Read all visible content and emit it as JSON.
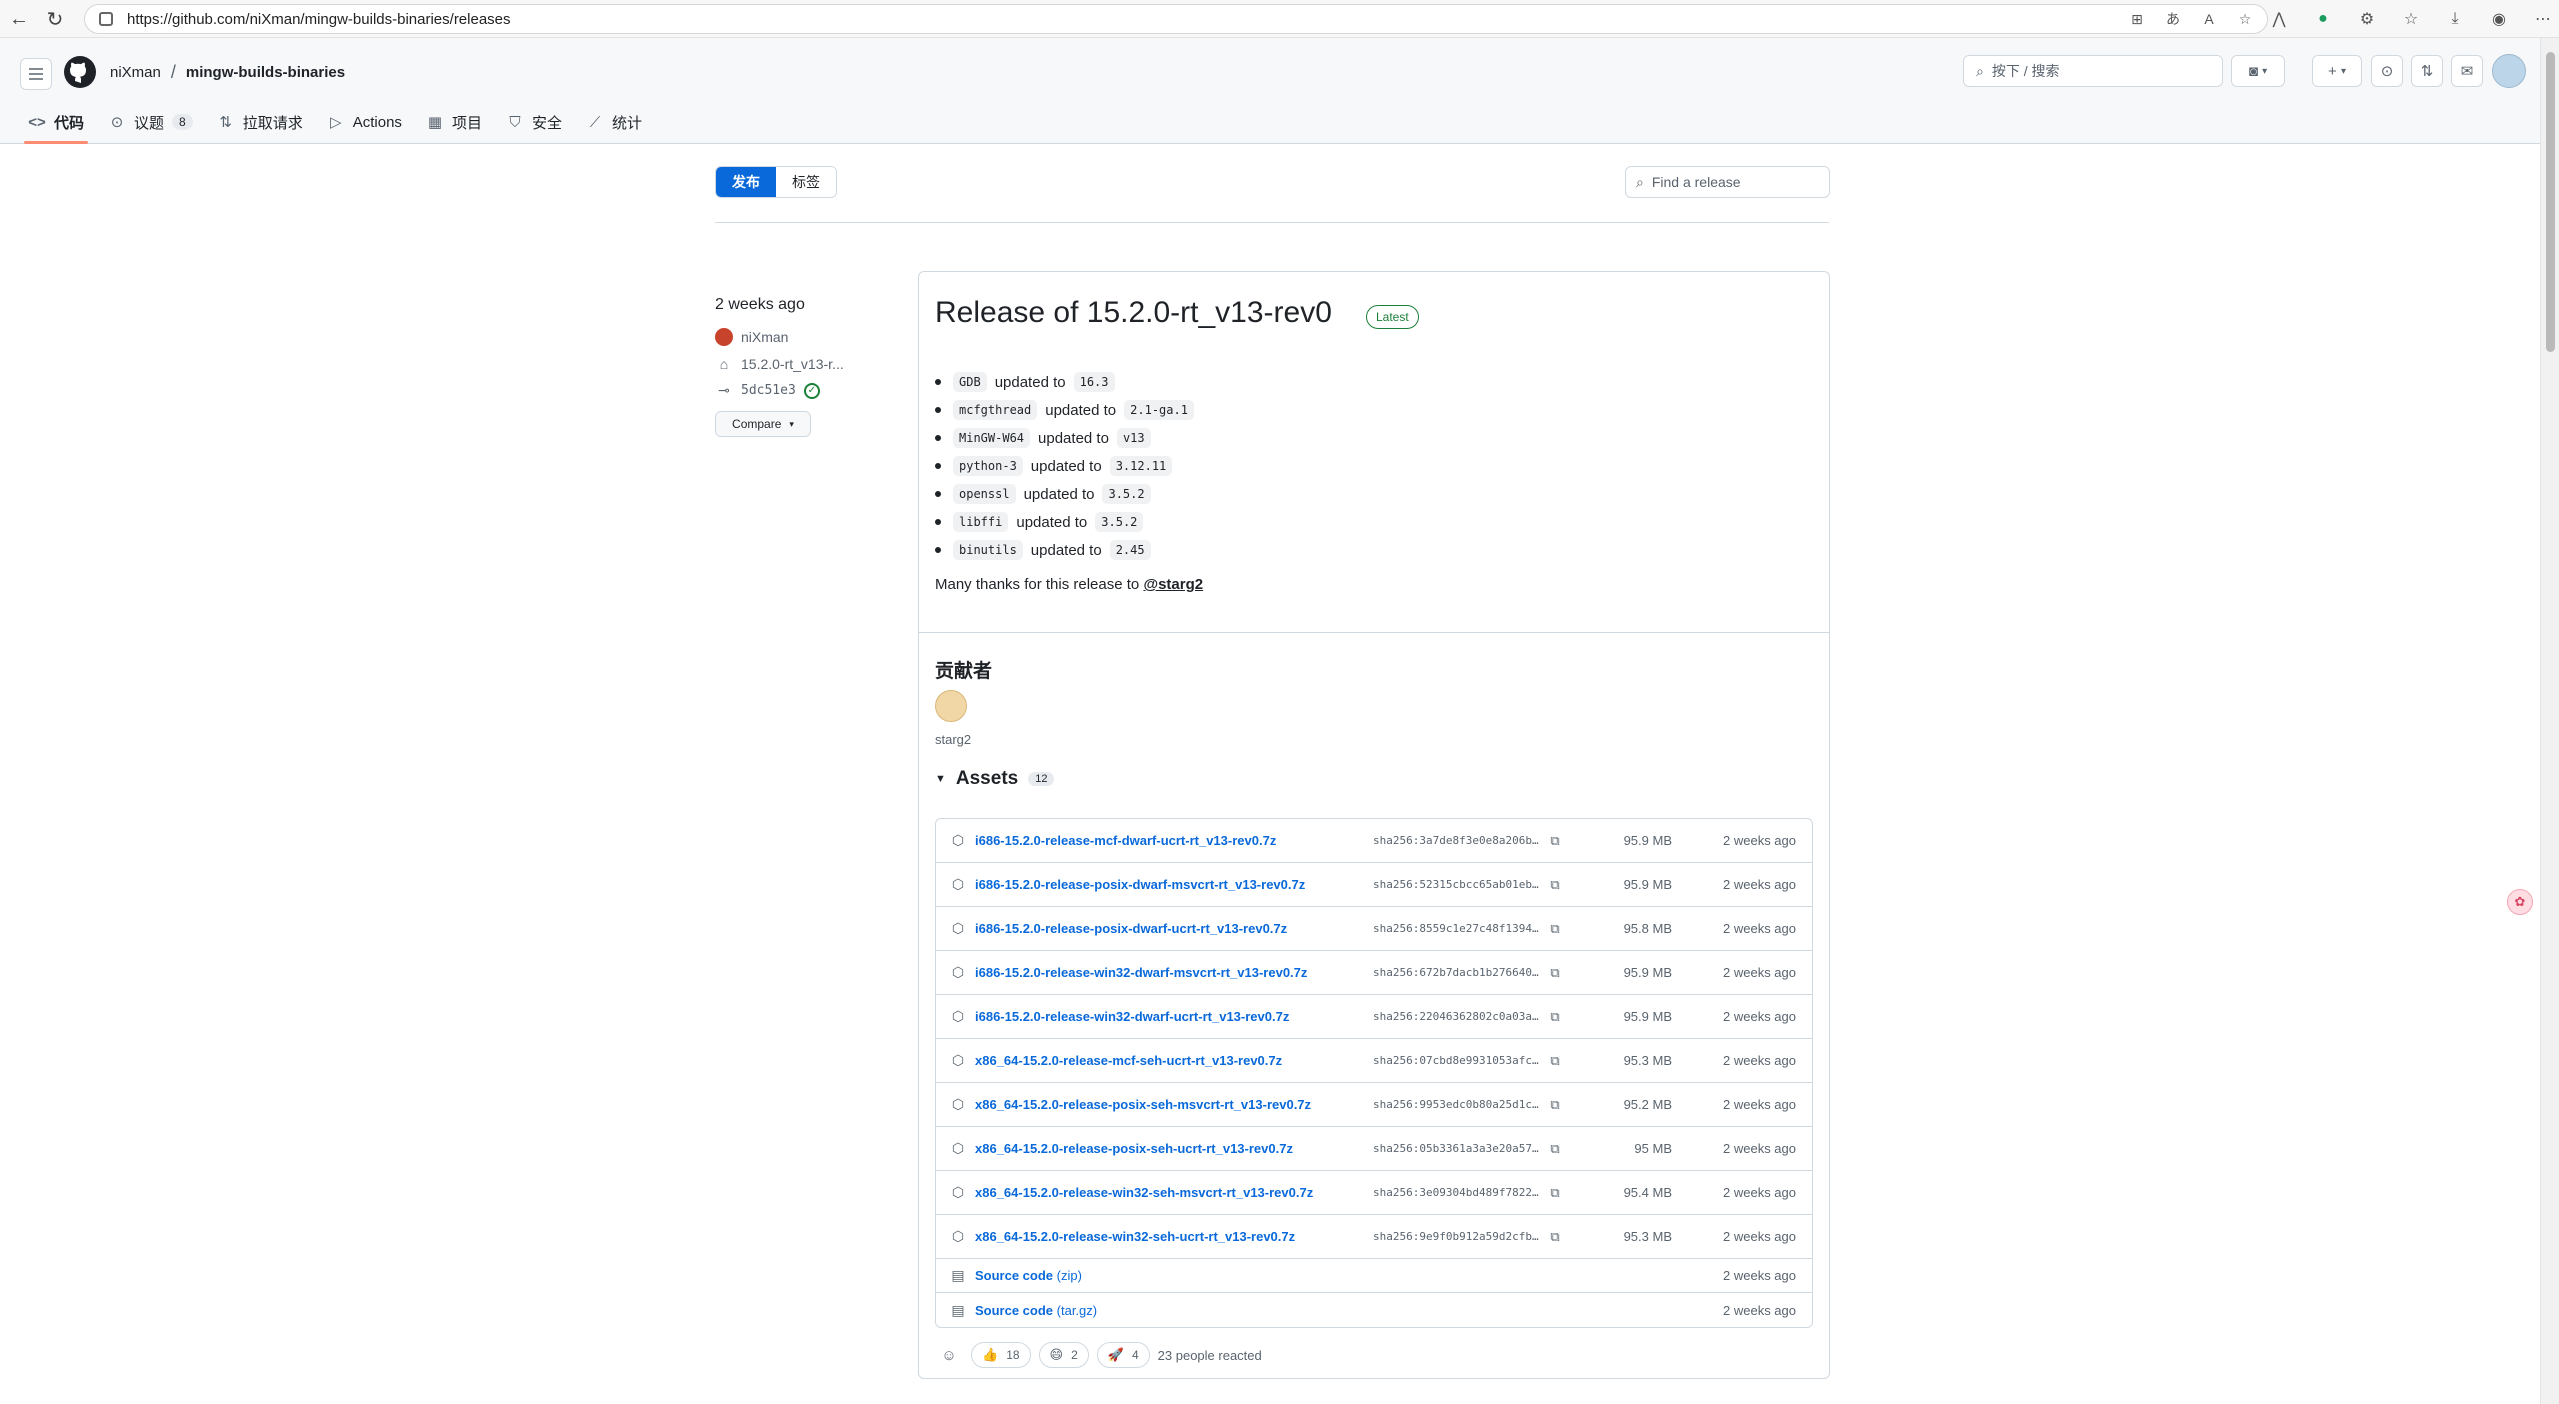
{
  "browser": {
    "url": "https://github.com/niXman/mingw-builds-binaries/releases"
  },
  "header": {
    "owner": "niXman",
    "separator": "/",
    "repo": "mingw-builds-binaries",
    "search_placeholder": "按下 / 搜索",
    "tabs": [
      {
        "label": "代码",
        "icon": "code-icon",
        "active": true
      },
      {
        "label": "议题",
        "icon": "issue-icon",
        "count": "8"
      },
      {
        "label": "拉取请求",
        "icon": "pull-request-icon"
      },
      {
        "label": "Actions",
        "icon": "play-icon"
      },
      {
        "label": "项目",
        "icon": "table-icon"
      },
      {
        "label": "安全",
        "icon": "shield-icon"
      },
      {
        "label": "统计",
        "icon": "graph-icon"
      }
    ]
  },
  "subnav": {
    "releases_label": "发布",
    "tags_label": "标签",
    "find_placeholder": "Find a release"
  },
  "meta": {
    "ago": "2 weeks ago",
    "author": "niXman",
    "tag": "15.2.0-rt_v13-r...",
    "commit": "5dc51e3",
    "compare_label": "Compare"
  },
  "release": {
    "title": "Release of 15.2.0-rt_v13-rev0",
    "badge": "Latest",
    "changes": [
      {
        "pkg": "GDB",
        "text": "updated to",
        "ver": "16.3"
      },
      {
        "pkg": "mcfgthread",
        "text": "updated to",
        "ver": "2.1-ga.1"
      },
      {
        "pkg": "MinGW-W64",
        "text": "updated to",
        "ver": "v13"
      },
      {
        "pkg": "python-3",
        "text": "updated to",
        "ver": "3.12.11"
      },
      {
        "pkg": "openssl",
        "text": "updated to",
        "ver": "3.5.2"
      },
      {
        "pkg": "libffi",
        "text": "updated to",
        "ver": "3.5.2"
      },
      {
        "pkg": "binutils",
        "text": "updated to",
        "ver": "2.45"
      }
    ],
    "thanks_text": "Many thanks for this release to",
    "thanks_mention": "@starg2",
    "contributors_title": "贡献者",
    "contributor": "starg2",
    "assets_title": "Assets",
    "assets_count": "12",
    "assets": [
      {
        "name": "i686-15.2.0-release-mcf-dwarf-ucrt-rt_v13-rev0.7z",
        "sha": "sha256:3a7de8f3e0e8a206b…",
        "size": "95.9 MB",
        "date": "2 weeks ago"
      },
      {
        "name": "i686-15.2.0-release-posix-dwarf-msvcrt-rt_v13-rev0.7z",
        "sha": "sha256:52315cbcc65ab01eb…",
        "size": "95.9 MB",
        "date": "2 weeks ago"
      },
      {
        "name": "i686-15.2.0-release-posix-dwarf-ucrt-rt_v13-rev0.7z",
        "sha": "sha256:8559c1e27c48f1394…",
        "size": "95.8 MB",
        "date": "2 weeks ago"
      },
      {
        "name": "i686-15.2.0-release-win32-dwarf-msvcrt-rt_v13-rev0.7z",
        "sha": "sha256:672b7dacb1b276640…",
        "size": "95.9 MB",
        "date": "2 weeks ago"
      },
      {
        "name": "i686-15.2.0-release-win32-dwarf-ucrt-rt_v13-rev0.7z",
        "sha": "sha256:22046362802c0a03a…",
        "size": "95.9 MB",
        "date": "2 weeks ago"
      },
      {
        "name": "x86_64-15.2.0-release-mcf-seh-ucrt-rt_v13-rev0.7z",
        "sha": "sha256:07cbd8e9931053afc…",
        "size": "95.3 MB",
        "date": "2 weeks ago"
      },
      {
        "name": "x86_64-15.2.0-release-posix-seh-msvcrt-rt_v13-rev0.7z",
        "sha": "sha256:9953edc0b80a25d1c…",
        "size": "95.2 MB",
        "date": "2 weeks ago"
      },
      {
        "name": "x86_64-15.2.0-release-posix-seh-ucrt-rt_v13-rev0.7z",
        "sha": "sha256:05b3361a3a3e20a57…",
        "size": "95 MB",
        "date": "2 weeks ago"
      },
      {
        "name": "x86_64-15.2.0-release-win32-seh-msvcrt-rt_v13-rev0.7z",
        "sha": "sha256:3e09304bd489f7822…",
        "size": "95.4 MB",
        "date": "2 weeks ago"
      },
      {
        "name": "x86_64-15.2.0-release-win32-seh-ucrt-rt_v13-rev0.7z",
        "sha": "sha256:9e9f0b912a59d2cfb…",
        "size": "95.3 MB",
        "date": "2 weeks ago"
      }
    ],
    "sources": [
      {
        "name": "Source code",
        "kind": "(zip)",
        "date": "2 weeks ago"
      },
      {
        "name": "Source code",
        "kind": "(tar.gz)",
        "date": "2 weeks ago"
      }
    ],
    "reactions": [
      {
        "emoji": "👍",
        "count": "18"
      },
      {
        "emoji": "😄",
        "count": "2"
      },
      {
        "emoji": "🚀",
        "count": "4"
      }
    ],
    "reactions_summary": "23 people reacted"
  }
}
